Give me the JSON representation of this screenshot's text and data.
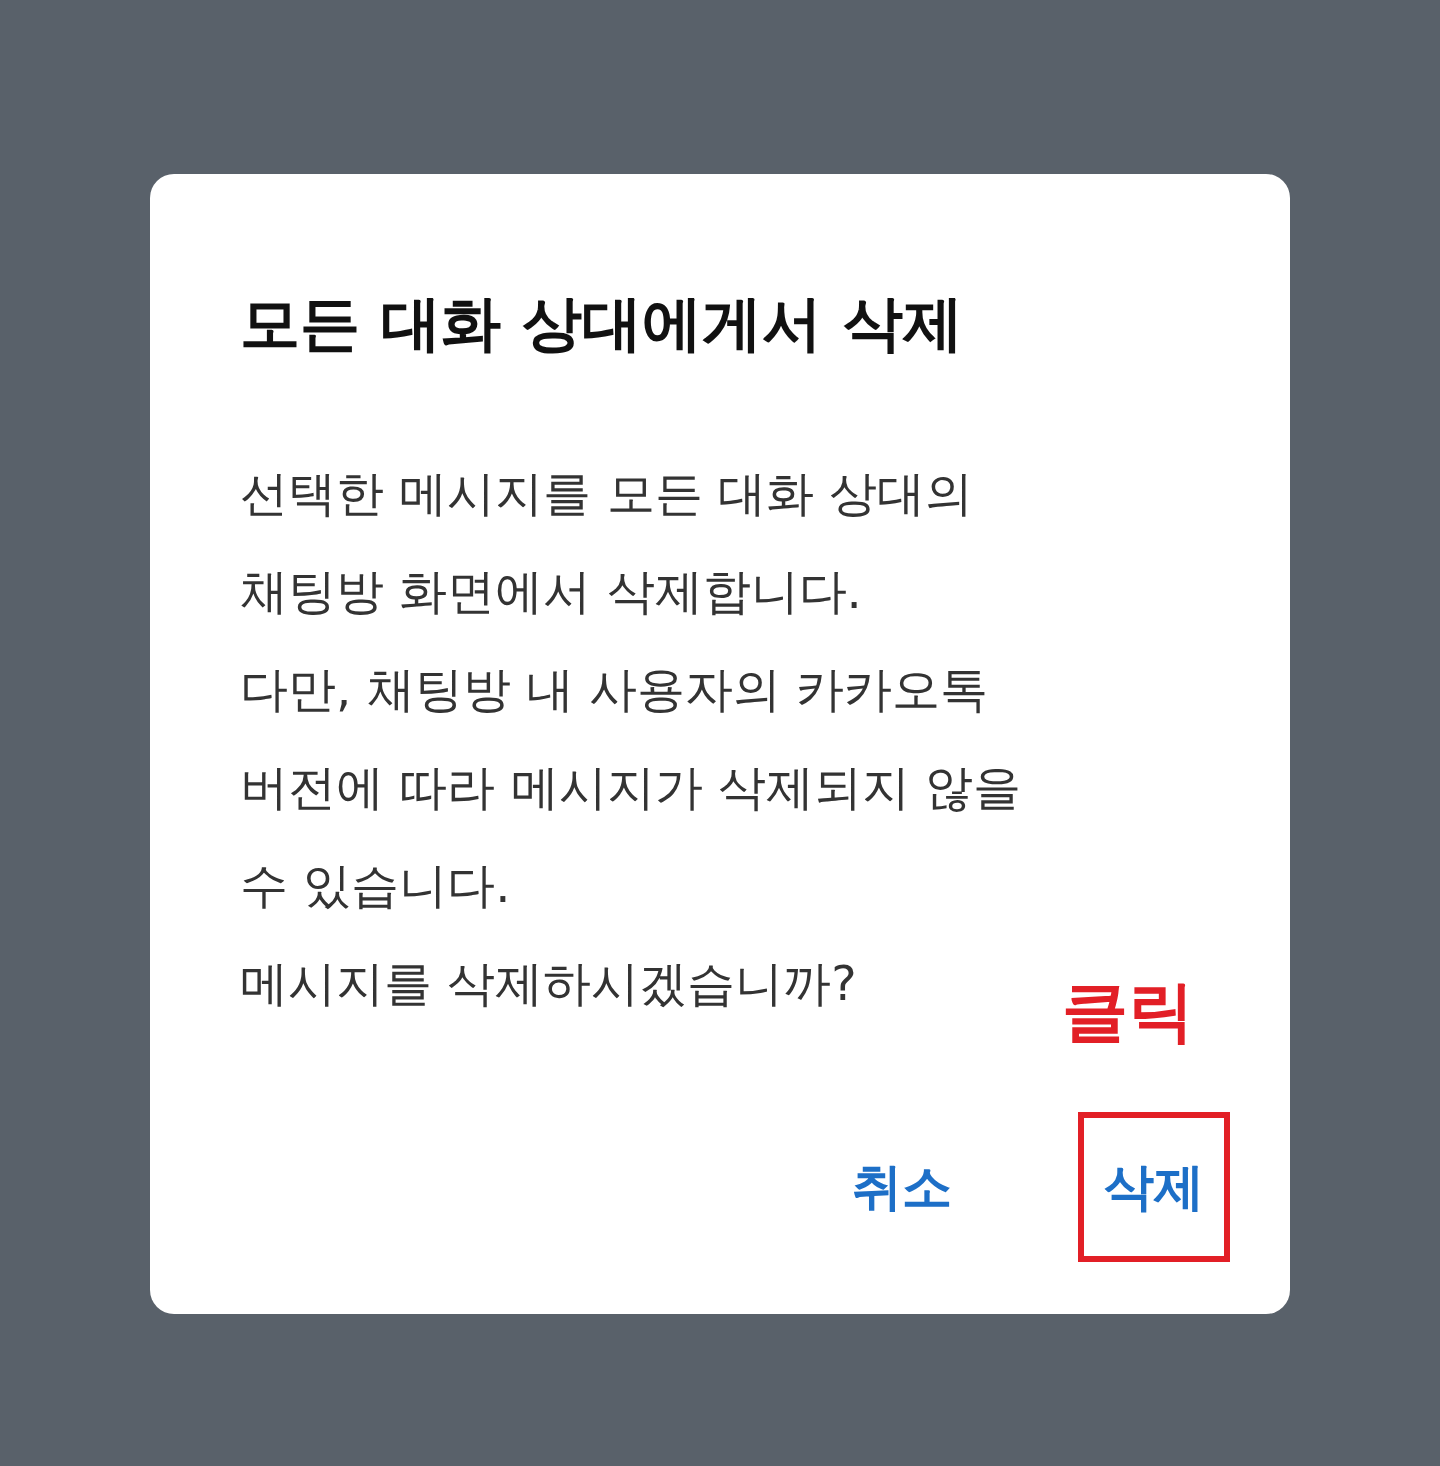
{
  "dialog": {
    "title": "모든 대화 상대에게서 삭제",
    "message_lines": [
      "선택한 메시지를 모든 대화 상대의",
      "채팅방 화면에서 삭제합니다.",
      "다만, 채팅방 내 사용자의 카카오톡",
      "버전에 따라 메시지가 삭제되지 않을",
      "수 있습니다.",
      "메시지를 삭제하시겠습니까?"
    ],
    "buttons": [
      {
        "label": "취소",
        "highlighted": false
      },
      {
        "label": "삭제",
        "highlighted": true,
        "annotation": "클릭"
      }
    ]
  }
}
